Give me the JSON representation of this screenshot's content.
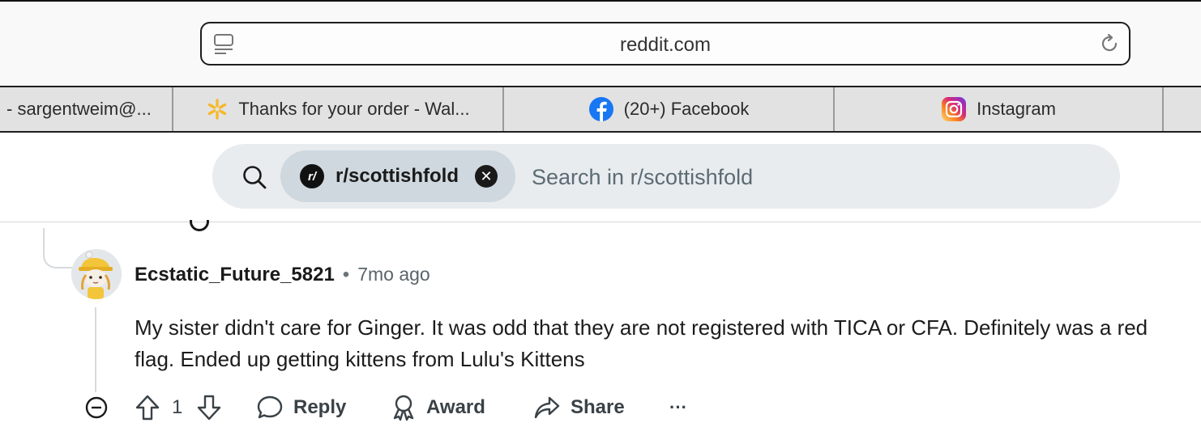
{
  "browser": {
    "address": "reddit.com"
  },
  "tabs": [
    {
      "label": "- sargentweim@...",
      "icon": "none"
    },
    {
      "label": "Thanks for your order - Wal...",
      "icon": "walmart-spark-icon"
    },
    {
      "label": "(20+) Facebook",
      "icon": "facebook-icon"
    },
    {
      "label": "Instagram",
      "icon": "instagram-icon"
    }
  ],
  "search": {
    "chip_label": "r/scottishfold",
    "chip_icon_text": "r/",
    "placeholder": "Search in r/scottishfold"
  },
  "comment": {
    "username": "Ecstatic_Future_5821",
    "separator": "•",
    "time": "7mo ago",
    "body": "My sister didn't care for Ginger. It was odd that they are not registered with TICA or CFA. Definitely was a red flag. Ended up getting kittens from Lulu's Kittens",
    "vote_count": "1",
    "reply_label": "Reply",
    "award_label": "Award",
    "share_label": "Share",
    "more_label": "···"
  },
  "colors": {
    "walmart_yellow": "#f5b92b",
    "facebook_blue": "#1877f2",
    "search_bg": "#e8ecef",
    "chip_bg": "#cfd8de"
  }
}
